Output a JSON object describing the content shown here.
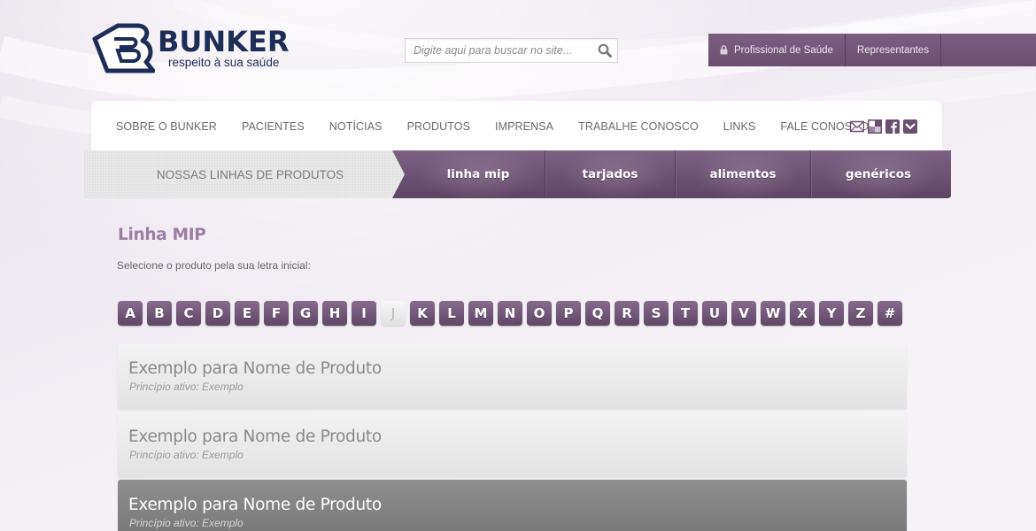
{
  "brand": {
    "name": "BUNKER",
    "tagline": "respeito à sua saúde"
  },
  "search": {
    "placeholder": "Digite aqui para buscar no site..."
  },
  "topbar": {
    "items": [
      "Profissional de Saúde",
      "Representantes"
    ]
  },
  "nav": {
    "items": [
      "SOBRE O BUNKER",
      "PACIENTES",
      "NOTÍCIAS",
      "PRODUTOS",
      "IMPRENSA",
      "TRABALHE CONOSCO",
      "LINKS",
      "FALE CONOSCO"
    ],
    "social_icons": [
      "email-icon",
      "delicious-icon",
      "facebook-icon",
      "orkut-icon"
    ]
  },
  "product_lines": {
    "label": "NOSSAS LINHAS DE PRODUTOS",
    "tabs": [
      "linha mip",
      "tarjados",
      "alimentos",
      "genéricos"
    ]
  },
  "content": {
    "title": "Linha MIP",
    "subtitle": "Selecione o produto pela sua letra inicial:",
    "letters": [
      "A",
      "B",
      "C",
      "D",
      "E",
      "F",
      "G",
      "H",
      "I",
      "J",
      "K",
      "L",
      "M",
      "N",
      "O",
      "P",
      "Q",
      "R",
      "S",
      "T",
      "U",
      "V",
      "W",
      "X",
      "Y",
      "Z",
      "#"
    ],
    "active_letter": "J",
    "products": [
      {
        "name": "Exemplo para Nome de Produto",
        "active_ingredient": "Princípio ativo: Exemplo",
        "selected": false
      },
      {
        "name": "Exemplo para Nome de Produto",
        "active_ingredient": "Princípio ativo: Exemplo",
        "selected": false
      },
      {
        "name": "Exemplo para Nome de Produto",
        "active_ingredient": "Princípio ativo: Exemplo",
        "selected": true
      }
    ]
  },
  "colors": {
    "accent_purple": "#6a4f70",
    "title_purple": "#9a7fa3",
    "logo_navy": "#1d2d57"
  }
}
